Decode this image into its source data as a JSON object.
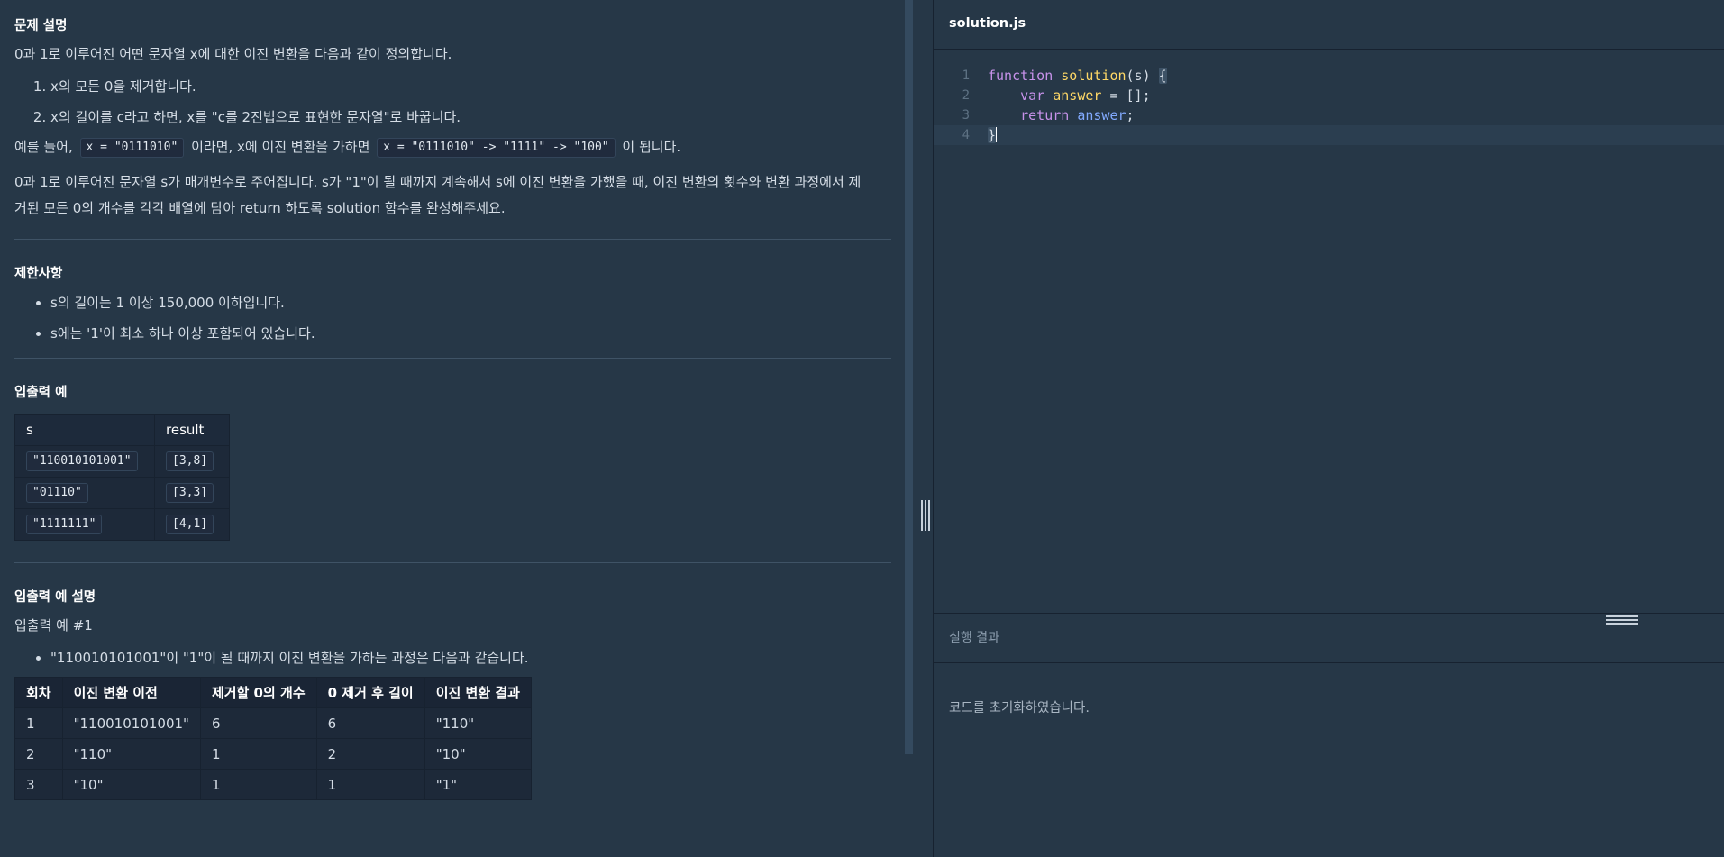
{
  "problem": {
    "title": "문제 설명",
    "intro": "0과 1로 이루어진 어떤 문자열 x에 대한 이진 변환을 다음과 같이 정의합니다.",
    "steps": [
      "x의 모든 0을 제거합니다.",
      "x의 길이를 c라고 하면, x를 \"c를 2진법으로 표현한 문자열\"로 바꿉니다."
    ],
    "example": {
      "prefix": "예를 들어,",
      "code1": "x = \"0111010\"",
      "middle": "이라면, x에 이진 변환을 가하면",
      "code2": "x = \"0111010\" -> \"1111\" -> \"100\"",
      "suffix": "이 됩니다."
    },
    "task_line1": "0과 1로 이루어진 문자열 s가 매개변수로 주어집니다. s가 \"1\"이 될 때까지 계속해서 s에 이진 변환을 가했을 때, 이진 변환의 횟수와 변환 과정에서 제",
    "task_line2": "거된 모든 0의 개수를 각각 배열에 담아 return 하도록 solution 함수를 완성해주세요."
  },
  "constraints": {
    "title": "제한사항",
    "items": [
      "s의 길이는 1 이상 150,000 이하입니다.",
      "s에는 '1'이 최소 하나 이상 포함되어 있습니다."
    ]
  },
  "io_example": {
    "title": "입출력 예",
    "headers": [
      "s",
      "result"
    ],
    "rows": [
      [
        "\"110010101001\"",
        "[3,8]"
      ],
      [
        "\"01110\"",
        "[3,3]"
      ],
      [
        "\"1111111\"",
        "[4,1]"
      ]
    ]
  },
  "io_explain": {
    "title": "입출력 예 설명",
    "subtitle": "입출력 예 #1",
    "bullet": "\"110010101001\"이 \"1\"이 될 때까지 이진 변환을 가하는 과정은 다음과 같습니다.",
    "headers": [
      "회차",
      "이진 변환 이전",
      "제거할 0의 개수",
      "0 제거 후 길이",
      "이진 변환 결과"
    ],
    "rows": [
      [
        "1",
        "\"110010101001\"",
        "6",
        "6",
        "\"110\""
      ],
      [
        "2",
        "\"110\"",
        "1",
        "2",
        "\"10\""
      ],
      [
        "3",
        "\"10\"",
        "1",
        "1",
        "\"1\""
      ]
    ]
  },
  "editor": {
    "file_name": "solution.js",
    "line_numbers": [
      "1",
      "2",
      "3",
      "4"
    ],
    "tokens": {
      "kw_function": "function",
      "fn_solution": "solution",
      "params": "(s) ",
      "brace_open": "{",
      "indent": "    ",
      "kw_var": "var",
      "var_answer": "answer",
      "assign": " = [];",
      "kw_return": "return",
      "id_answer": "answer",
      "semi": ";",
      "brace_close": "}"
    }
  },
  "result": {
    "title": "실행 결과",
    "message": "코드를 초기화하였습니다."
  }
}
